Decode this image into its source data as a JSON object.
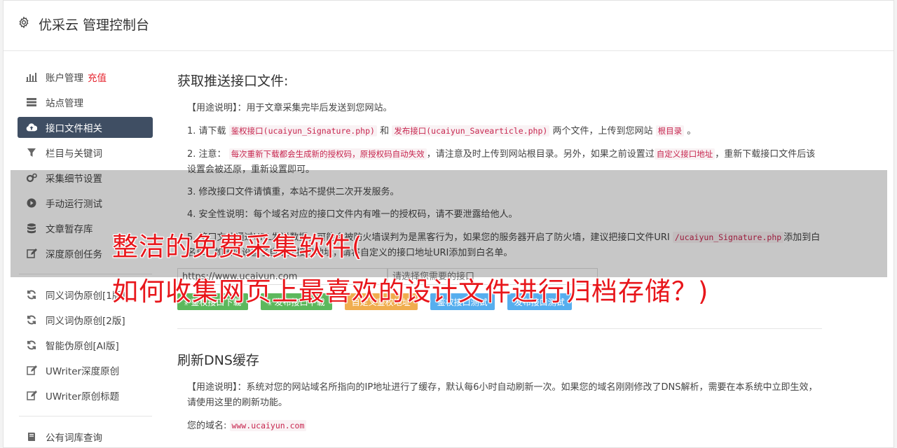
{
  "header": {
    "title": "优采云 管理控制台",
    "icon": "gear-icon"
  },
  "sidebar": {
    "items": [
      {
        "label": "账户管理",
        "extra": "充值",
        "icon": "bar-chart-icon"
      },
      {
        "label": "站点管理",
        "icon": "server-icon"
      },
      {
        "label": "接口文件相关",
        "icon": "cloud-upload-icon",
        "active": true
      },
      {
        "label": "栏目与关键词",
        "icon": "filter-icon"
      },
      {
        "label": "采集细节设置",
        "icon": "cogs-icon"
      },
      {
        "label": "手动运行测试",
        "icon": "play-icon"
      },
      {
        "label": "文章暂存库",
        "icon": "database-icon"
      },
      {
        "label": "深度原创任务",
        "icon": "edit-icon"
      },
      {
        "label": "同义词伪原创[1版]",
        "icon": "refresh-icon"
      },
      {
        "label": "同义词伪原创[2版]",
        "icon": "refresh-icon"
      },
      {
        "label": "智能伪原创[AI版]",
        "icon": "refresh-icon"
      },
      {
        "label": "UWriter深度原创",
        "icon": "edit-icon"
      },
      {
        "label": "UWriter原创标题",
        "icon": "edit-icon"
      },
      {
        "label": "公有词库查询",
        "icon": "book-icon"
      }
    ]
  },
  "section1": {
    "title": "获取推送接口文件:",
    "usage_label": "【用途说明】",
    "usage_text": "：用于文章采集完毕后发送到您网站。",
    "p1_a": "1. 请下载",
    "p1_code1": "鉴权接口(ucaiyun_Signature.php)",
    "p1_b": "和",
    "p1_code2": "发布接口(ucaiyun_Savearticle.php)",
    "p1_c": "两个文件，上传到您网站",
    "p1_code3": "根目录",
    "p1_d": "。",
    "p2_a": "2. 注意：",
    "p2_code1": "每次重新下载都会生成新的授权码，原授权码自动失效",
    "p2_b": "，请注意及时上传到网站根目录。另外，如果之前设置过",
    "p2_code2": "自定义接口地址",
    "p2_c": "，重新下载接口文件后该设置会被还原，重新设置即可。",
    "p3": "3. 修改接口文件请慎重，本站不提供二次开发服务。",
    "p4": "4. 安全性说明：每个域名对应的接口文件内有唯一的授权码，请不要泄露给他人。",
    "p5_a": "5. 接口文件通过URL发送数据，可能会被防火墙误判为是黑客行为，如果您的服务器开启了防火墙，建议把接口文件URI",
    "p5_code": "/ucaiyun_Signature.php",
    "p5_b": "添加到白名单，如果您设置了自定义接口地址，请将自定义的接口地址URI添加到白名单。",
    "url_value": "https://www.ucaiyun.com",
    "url_placeholder": "请选择您需要的接口",
    "buttons": {
      "download_auth": "鉴权接口下载",
      "download_publish": "发布接口下载",
      "custom_auth": "自定义鉴权地址",
      "test_auth": "鉴权接口测试",
      "test_publish": "发布接口测试"
    }
  },
  "section2": {
    "title": "刷新DNS缓存",
    "usage_label": "【用途说明】",
    "usage_text": "：系统对您的网站域名所指向的IP地址进行了缓存，默认每6小时自动刷新一次。如果您的域名刚刚修改了DNS解析，需要在本系统中立即生效，请使用这里的刷新功能。",
    "domain_label": "您的域名:",
    "domain_value": "www.ucaiyun.com"
  },
  "overlay": {
    "line1": "整洁的免费采集软件(",
    "line2": "如何收集网页上最喜欢的设计文件进行归档存储？)"
  },
  "colors": {
    "active_bg": "#3f4e63",
    "red": "#e5232d",
    "green": "#5cb85c",
    "orange": "#f0ad4e",
    "blue": "#56aeee"
  }
}
